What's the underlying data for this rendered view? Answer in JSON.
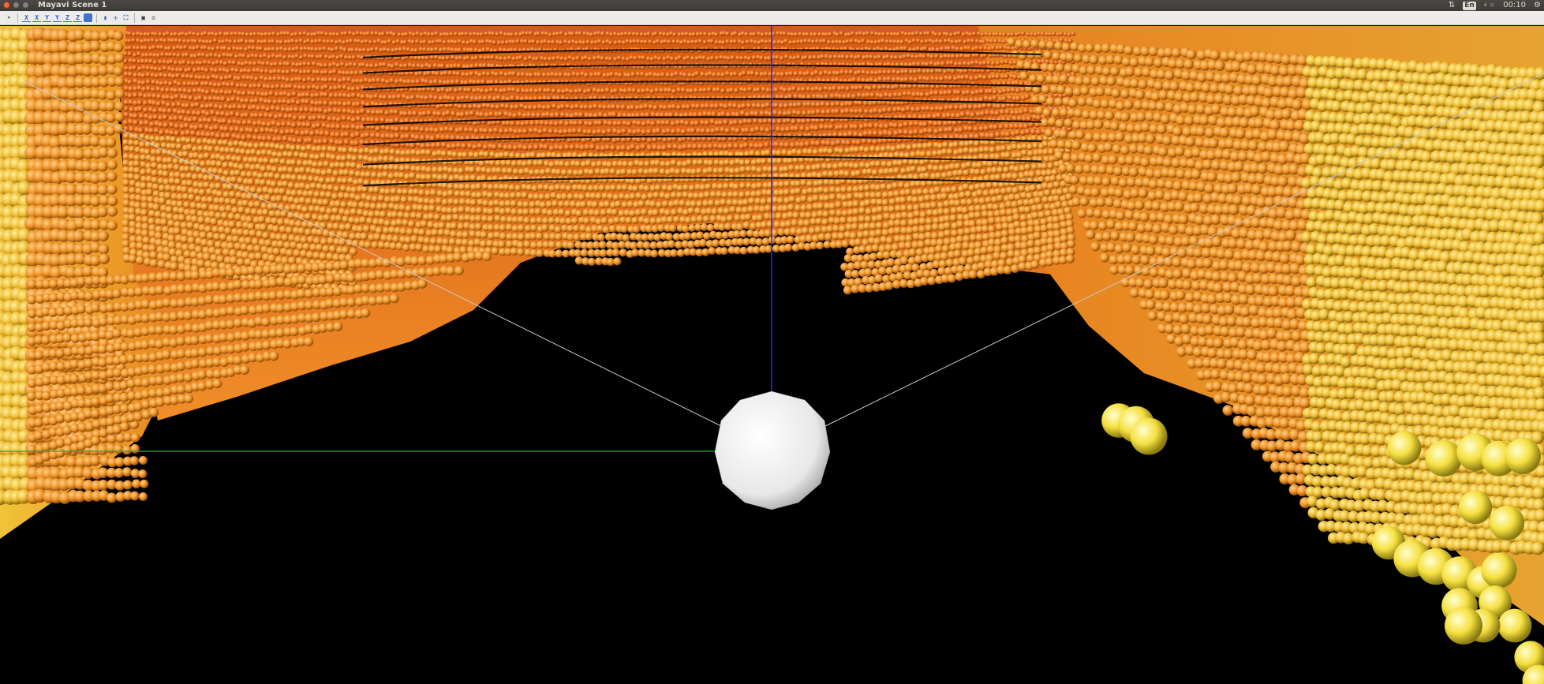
{
  "window": {
    "title": "Mayavi Scene 1",
    "buttons": [
      "close",
      "minimize",
      "maximize"
    ]
  },
  "system_tray": {
    "network_icon": "up-down-arrows-icon",
    "language": "En",
    "volume_icon": "speaker-muted-icon",
    "clock": "00:10",
    "settings_icon": "gear-icon"
  },
  "toolbar": {
    "items": [
      {
        "name": "pipeline-icon",
        "glyph": "➤"
      },
      {
        "name": "view-plus-x-icon",
        "glyph": "X"
      },
      {
        "name": "view-minus-x-icon",
        "glyph": "X"
      },
      {
        "name": "view-plus-y-icon",
        "glyph": "Y"
      },
      {
        "name": "view-minus-y-icon",
        "glyph": "Y"
      },
      {
        "name": "view-plus-z-icon",
        "glyph": "Z"
      },
      {
        "name": "view-minus-z-icon",
        "glyph": "Z"
      },
      {
        "name": "isometric-view-icon",
        "glyph": ""
      },
      {
        "name": "parallel-projection-icon",
        "glyph": "▮"
      },
      {
        "name": "toggle-axes-icon",
        "glyph": "✣"
      },
      {
        "name": "full-screen-icon",
        "glyph": "⛶"
      },
      {
        "name": "save-icon",
        "glyph": "💾"
      },
      {
        "name": "configure-scene-icon",
        "glyph": "⚙"
      }
    ]
  },
  "scene": {
    "background": "#000000",
    "colors": {
      "point_near": "#f2c13a",
      "point_mid": "#f0932a",
      "point_far": "#e86a1c",
      "point_close": "#f5e84a",
      "sensor_sphere": "#ffffff",
      "axis_x": "#00c040",
      "axis_z": "#2020ff",
      "fov_lines": "#c8c8c8"
    }
  }
}
